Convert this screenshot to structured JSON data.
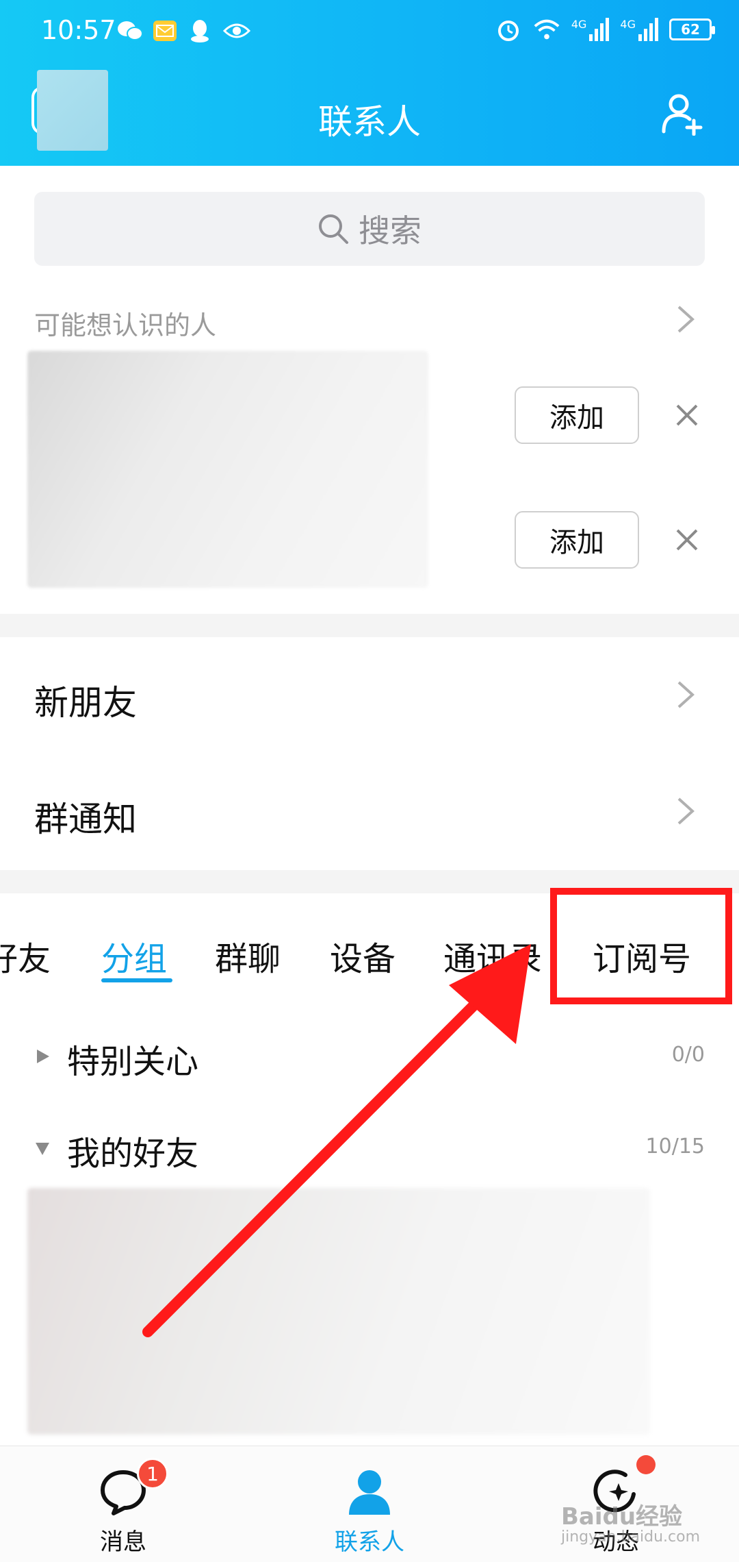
{
  "status_bar": {
    "time": "10:57",
    "battery": "62",
    "network": "4G"
  },
  "header": {
    "title": "联系人"
  },
  "search": {
    "label": "搜索"
  },
  "suggestions": {
    "title": "可能想认识的人",
    "add_label": "添加"
  },
  "list_rows": {
    "new_friends": "新朋友",
    "group_notice": "群通知"
  },
  "tabs": [
    {
      "label": "好友"
    },
    {
      "label": "分组"
    },
    {
      "label": "群聊"
    },
    {
      "label": "设备"
    },
    {
      "label": "通讯录"
    },
    {
      "label": "订阅号"
    }
  ],
  "active_tab": "分组",
  "groups": [
    {
      "name": "特别关心",
      "count": "0/0",
      "expanded": false
    },
    {
      "name": "我的好友",
      "count": "10/15",
      "expanded": true
    }
  ],
  "bottom_nav": {
    "messages": "消息",
    "messages_badge": "1",
    "contacts": "联系人",
    "moments": "动态"
  },
  "watermark": {
    "text": "Baidu经验",
    "sub": "jingyan.baidu.com"
  },
  "colors": {
    "header_start": "#15c9f5",
    "header_end": "#0aa6f5",
    "accent": "#12a2e8",
    "badge": "#f44a3a",
    "highlight": "#ff1a1a"
  }
}
